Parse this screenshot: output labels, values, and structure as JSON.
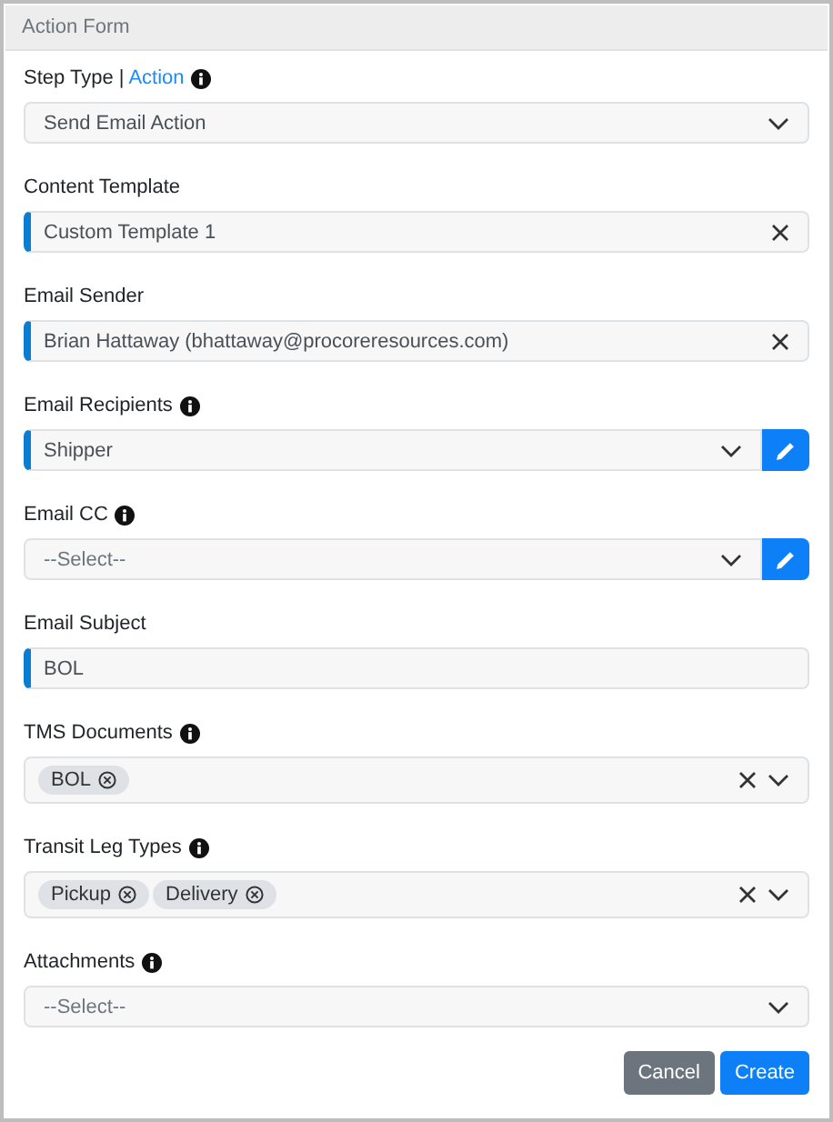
{
  "panel": {
    "title": "Action Form"
  },
  "fields": [
    {
      "kind": "select",
      "label": "Step Type | ",
      "label_link": "Action",
      "info": true,
      "required": false,
      "value": "Send Email Action",
      "clearable": false,
      "edit_button": false
    },
    {
      "kind": "text",
      "label": "Content Template",
      "info": false,
      "required": true,
      "value": "Custom Template 1",
      "clearable": true,
      "edit_button": false
    },
    {
      "kind": "text",
      "label": "Email Sender",
      "info": false,
      "required": true,
      "value": "Brian Hattaway (bhattaway@procoreresources.com)",
      "clearable": true,
      "edit_button": false
    },
    {
      "kind": "select",
      "label": "Email Recipients",
      "info": true,
      "required": true,
      "value": "Shipper",
      "clearable": false,
      "edit_button": true
    },
    {
      "kind": "select",
      "label": "Email CC",
      "info": true,
      "required": false,
      "placeholder": "--Select--",
      "clearable": false,
      "edit_button": true
    },
    {
      "kind": "text",
      "label": "Email Subject",
      "info": false,
      "required": true,
      "value": "BOL",
      "clearable": false,
      "edit_button": false
    },
    {
      "kind": "multi",
      "label": "TMS Documents",
      "info": true,
      "required": false,
      "tags": [
        "BOL"
      ],
      "clearable": true,
      "edit_button": false
    },
    {
      "kind": "multi",
      "label": "Transit Leg Types",
      "info": true,
      "required": false,
      "tags": [
        "Pickup",
        "Delivery"
      ],
      "clearable": true,
      "edit_button": false
    },
    {
      "kind": "select",
      "label": "Attachments",
      "info": true,
      "required": false,
      "placeholder": "--Select--",
      "clearable": false,
      "edit_button": false
    }
  ],
  "buttons": [
    {
      "kind": "secondary",
      "label": "Cancel"
    },
    {
      "kind": "primary",
      "label": "Create"
    }
  ]
}
